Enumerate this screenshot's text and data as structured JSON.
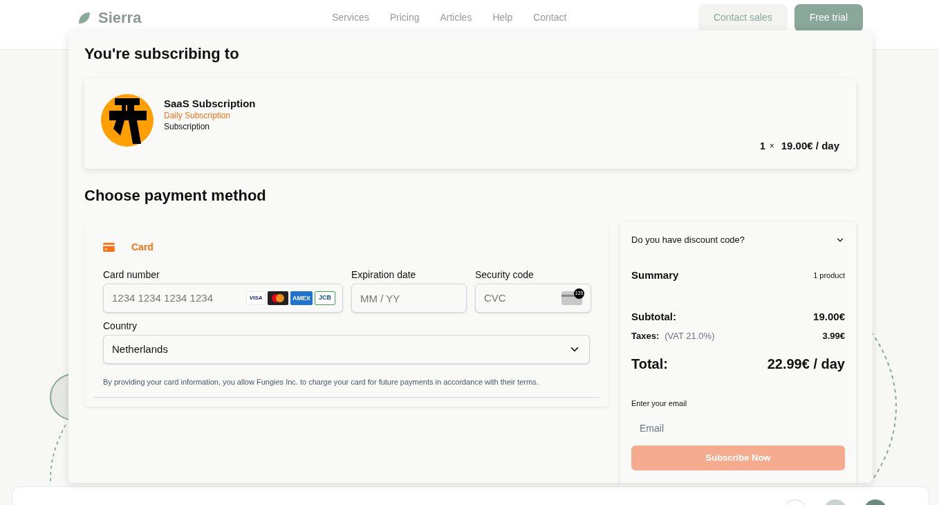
{
  "header": {
    "logo": "Sierra",
    "nav": [
      "Services",
      "Pricing",
      "Articles",
      "Help",
      "Contact"
    ],
    "buttons": [
      {
        "label": "Contact sales",
        "kind": "secondary"
      },
      {
        "label": "Free trial",
        "kind": "primary"
      }
    ]
  },
  "checkout": {
    "title": "You're subscribing to",
    "product": {
      "name": "SaaS Subscription",
      "plan": "Daily Subscription",
      "type": "Subscription",
      "quantity": "1",
      "times": "×",
      "price": "19.00€ / day"
    },
    "payment_title": "Choose payment method",
    "methods": [
      {
        "label": "Card",
        "selected": true
      }
    ],
    "card_number": {
      "label": "Card number",
      "placeholder": "1234 1234 1234 1234"
    },
    "card_brands": [
      {
        "kind": "visa",
        "label": "VISA"
      },
      {
        "kind": "mastercard"
      },
      {
        "kind": "amex",
        "label": "AMEX"
      },
      {
        "kind": "jcb",
        "label": "JCB"
      }
    ],
    "expiration": {
      "label": "Expiration date",
      "placeholder": "MM / YY"
    },
    "security": {
      "label": "Security code",
      "placeholder": "CVC",
      "badge": "135"
    },
    "country": {
      "label": "Country",
      "value": "Netherlands"
    },
    "notice": "By providing your card information, you allow Fungies Inc. to charge your card for future payments in accordance with their terms.",
    "discount": {
      "label": "Do you have discount code?",
      "expanded": false
    },
    "summary": {
      "title": "Summary",
      "count": "1 product",
      "subtotal_label": "Subtotal:",
      "subtotal": "19.00€",
      "taxes_label": "Taxes:",
      "taxes_note": "(VAT 21.0%)",
      "taxes": "3.99€",
      "total_label": "Total:",
      "total": "22.99€ / day"
    },
    "email": {
      "label": "Enter your email",
      "placeholder": "Email"
    },
    "submit": {
      "label": "Subscribe Now",
      "disabled": true
    }
  }
}
